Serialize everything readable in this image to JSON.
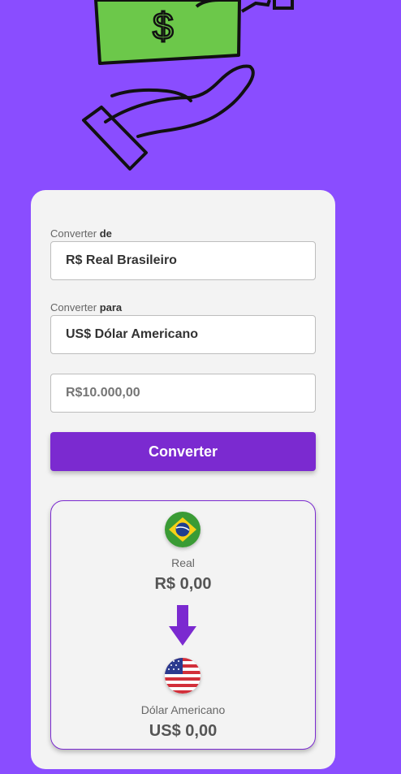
{
  "form": {
    "from_label_prefix": "Converter",
    "from_label_bold": "de",
    "from_selected": "R$ Real Brasileiro",
    "to_label_prefix": "Converter",
    "to_label_bold": "para",
    "to_selected": "US$ Dólar Americano",
    "amount_placeholder": "R$10.000,00",
    "convert_label": "Converter"
  },
  "result": {
    "from_name": "Real",
    "from_value": "R$ 0,00",
    "to_name": "Dólar Americano",
    "to_value": "US$ 0,00",
    "from_flag": "brazil-flag-icon",
    "to_flag": "usa-flag-icon"
  },
  "colors": {
    "background": "#8a4dff",
    "accent": "#7b2ad0",
    "card": "#f3f3f3"
  }
}
